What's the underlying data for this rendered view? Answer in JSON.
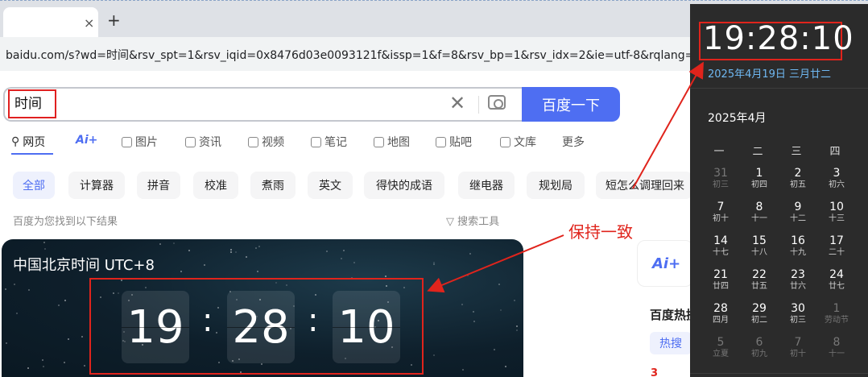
{
  "browser": {
    "tab_close": "×",
    "new_tab": "+",
    "url": "baidu.com/s?wd=时间&rsv_spt=1&rsv_iqid=0x8476d03e0093121f&issp=1&f=8&rsv_bp=1&rsv_idx=2&ie=utf-8&rqlang=cn&tn"
  },
  "search": {
    "query": "时间",
    "clear": "✕",
    "button": "百度一下"
  },
  "nav": {
    "items": [
      {
        "label": "网页",
        "icon": "search-icon"
      },
      {
        "label": "",
        "icon": "ai-icon",
        "icon_text": "Ai+"
      },
      {
        "label": "图片",
        "icon": "image-icon"
      },
      {
        "label": "资讯",
        "icon": "news-icon"
      },
      {
        "label": "视频",
        "icon": "video-icon"
      },
      {
        "label": "笔记",
        "icon": "note-icon"
      },
      {
        "label": "地图",
        "icon": "map-icon"
      },
      {
        "label": "贴吧",
        "icon": "tieba-icon"
      },
      {
        "label": "文库",
        "icon": "doc-icon"
      },
      {
        "label": "更多",
        "icon": ""
      }
    ]
  },
  "chips": [
    "全部",
    "计算器",
    "拼音",
    "校准",
    "煮雨",
    "英文",
    "得快的成语",
    "继电器",
    "规划局",
    "短怎么调理回来"
  ],
  "result_count": "百度为您找到以下结果",
  "search_tools": "搜索工具",
  "clock_card": {
    "title": "中国北京时间 UTC+8",
    "hours": "19",
    "minutes": "28",
    "seconds": "10",
    "separator": ":"
  },
  "annotation": {
    "text": "保持一致",
    "color": "#e0241c"
  },
  "right_panel": {
    "ai_logo": "Ai+",
    "hot_title": "百度热搜",
    "hot_tab": "热搜",
    "hot_item_num": "3"
  },
  "flyout": {
    "time": "19:28:10",
    "date": "2025年4月19日 三月廿二",
    "month": "2025年4月",
    "weekdays": [
      "一",
      "二",
      "三",
      "四"
    ],
    "weeks": [
      [
        {
          "n": "31",
          "l": "初三",
          "dim": true
        },
        {
          "n": "1",
          "l": "初四"
        },
        {
          "n": "2",
          "l": "初五"
        },
        {
          "n": "3",
          "l": "初六"
        }
      ],
      [
        {
          "n": "7",
          "l": "初十"
        },
        {
          "n": "8",
          "l": "十一"
        },
        {
          "n": "9",
          "l": "十二"
        },
        {
          "n": "10",
          "l": "十三"
        }
      ],
      [
        {
          "n": "14",
          "l": "十七"
        },
        {
          "n": "15",
          "l": "十八"
        },
        {
          "n": "16",
          "l": "十九"
        },
        {
          "n": "17",
          "l": "二十"
        }
      ],
      [
        {
          "n": "21",
          "l": "廿四"
        },
        {
          "n": "22",
          "l": "廿五"
        },
        {
          "n": "23",
          "l": "廿六"
        },
        {
          "n": "24",
          "l": "廿七"
        }
      ],
      [
        {
          "n": "28",
          "l": "四月"
        },
        {
          "n": "29",
          "l": "初二"
        },
        {
          "n": "30",
          "l": "初三"
        },
        {
          "n": "1",
          "l": "劳动节",
          "dim": true
        }
      ],
      [
        {
          "n": "5",
          "l": "立夏",
          "dim": true
        },
        {
          "n": "6",
          "l": "初九",
          "dim": true
        },
        {
          "n": "7",
          "l": "初十",
          "dim": true
        },
        {
          "n": "8",
          "l": "十一",
          "dim": true
        }
      ]
    ]
  }
}
